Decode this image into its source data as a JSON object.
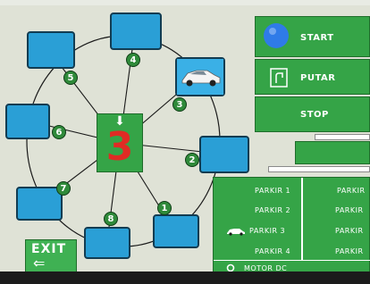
{
  "parking_map": {
    "selected_slot": "3",
    "slot_numbers": [
      "1",
      "2",
      "3",
      "4",
      "5",
      "6",
      "7",
      "8"
    ],
    "occupied_slot": "3"
  },
  "controls": {
    "start_label": "START",
    "rotate_label": "PUTAR",
    "stop_label": "STOP",
    "start_indicator_color": "#2f7be8"
  },
  "status_panel": {
    "rows_left": [
      "PARKIR 1",
      "PARKIR 2",
      "PARKIR 3",
      "PARKIR 4"
    ],
    "rows_right": [
      "PARKIR",
      "PARKIR",
      "PARKIR",
      "PARKIR"
    ],
    "motor_label": "MOTOR DC"
  },
  "exit": {
    "label": "EXIT",
    "arrow": "⇐"
  },
  "colors": {
    "panel_green": "#35a447",
    "slot_blue": "#2a9fd6",
    "badge_green": "#2f8a3a",
    "digit_red": "#e02b24"
  }
}
